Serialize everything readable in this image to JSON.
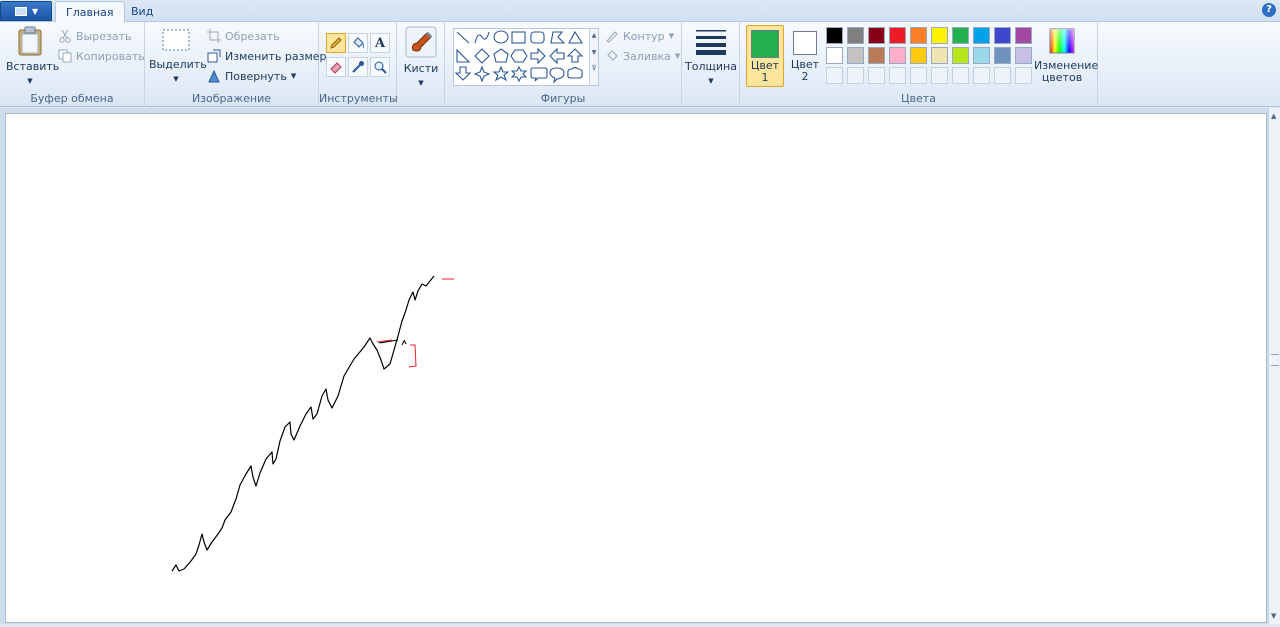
{
  "tabs": [
    {
      "label": "Главная",
      "active": true
    },
    {
      "label": "Вид",
      "active": false
    }
  ],
  "help_label": "?",
  "clipboard": {
    "paste_label": "Вставить",
    "cut_label": "Вырезать",
    "copy_label": "Копировать",
    "group_label": "Буфер обмена"
  },
  "image": {
    "select_label": "Выделить",
    "crop_label": "Обрезать",
    "resize_label": "Изменить размер",
    "rotate_label": "Повернуть",
    "group_label": "Изображение"
  },
  "tools": {
    "group_label": "Инструменты",
    "text_glyph": "A",
    "items": [
      "pencil",
      "fill",
      "text",
      "eraser",
      "color-picker",
      "magnifier"
    ]
  },
  "brushes": {
    "label": "Кисти"
  },
  "shapes": {
    "group_label": "Фигуры",
    "outline_label": "Контур",
    "fill_label": "Заливка",
    "items": [
      "line",
      "curve",
      "oval",
      "rectangle",
      "rounded-rectangle",
      "polygon",
      "triangle",
      "right-triangle",
      "diamond",
      "pentagon",
      "hexagon",
      "right-arrow",
      "left-arrow",
      "up-arrow",
      "down-arrow",
      "four-point-star",
      "five-point-star",
      "six-point-star",
      "rounded-callout",
      "oval-callout",
      "cloud-callout"
    ]
  },
  "thickness": {
    "label": "Толщина"
  },
  "colors": {
    "group_label": "Цвета",
    "color1_label": "Цвет 1",
    "color2_label": "Цвет 2",
    "color1_value": "#22b14c",
    "color2_value": "#ffffff",
    "edit_label": "Изменение цветов",
    "palette_row1": [
      "#000000",
      "#7f7f7f",
      "#880015",
      "#ed1c24",
      "#ff7f27",
      "#fff200",
      "#22b14c",
      "#00a2e8",
      "#3f48cc",
      "#a349a4"
    ],
    "palette_row2": [
      "#ffffff",
      "#c3c3c3",
      "#b97a57",
      "#ffaec9",
      "#ffc90e",
      "#efe4b0",
      "#b5e61d",
      "#99d9ea",
      "#7092be",
      "#c8bfe7"
    ]
  },
  "accent": "#e0a72c",
  "ui_blue": "#1e395b"
}
